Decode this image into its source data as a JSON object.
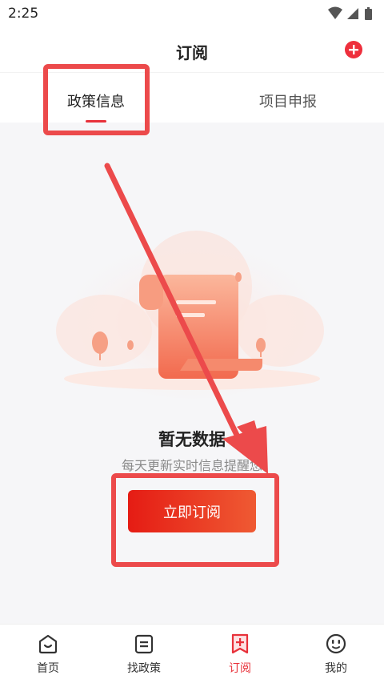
{
  "status_bar": {
    "time": "2:25",
    "icons": [
      "wifi-icon",
      "signal-icon",
      "battery-icon"
    ]
  },
  "header": {
    "title": "订阅",
    "add_icon": "plus-circle-icon"
  },
  "tabs": [
    {
      "label": "政策信息",
      "active": true
    },
    {
      "label": "项目申报",
      "active": false
    }
  ],
  "empty_state": {
    "title": "暂无数据",
    "subtitle": "每天更新实时信息提醒您",
    "button_label": "立即订阅"
  },
  "bottom_nav": [
    {
      "label": "首页",
      "icon": "home-icon",
      "active": false
    },
    {
      "label": "找政策",
      "icon": "document-icon",
      "active": false
    },
    {
      "label": "订阅",
      "icon": "subscribe-icon",
      "active": true
    },
    {
      "label": "我的",
      "icon": "profile-face-icon",
      "active": false
    }
  ],
  "colors": {
    "accent": "#e8313a",
    "annotation": "#ec4a4b",
    "button_start": "#e51c14",
    "button_end": "#ef5a33"
  }
}
